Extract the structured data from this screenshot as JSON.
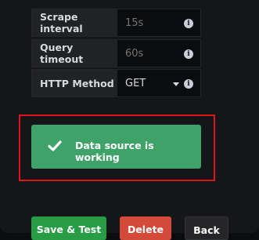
{
  "settings": {
    "rows": [
      {
        "label": "Scrape interval",
        "placeholder": "15s"
      },
      {
        "label": "Query timeout",
        "placeholder": "60s"
      },
      {
        "label": "HTTP Method",
        "value": "GET"
      }
    ]
  },
  "alert": {
    "message": "Data source is working",
    "color": "#3fa268"
  },
  "buttons": {
    "save": "Save & Test",
    "delete": "Delete",
    "back": "Back"
  },
  "icons": {
    "info": "info-circle-icon",
    "check": "check-icon",
    "caret": "caret-down-icon"
  },
  "colors": {
    "highlight_border": "#e0141c",
    "save": "#299c46",
    "delete": "#d44a3a"
  }
}
